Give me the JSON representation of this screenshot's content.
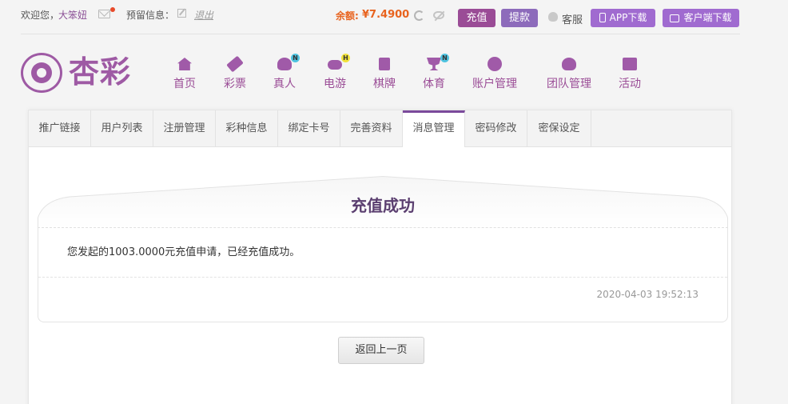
{
  "topbar": {
    "welcome": "欢迎您，",
    "username": "大笨妞",
    "reserve_label": "预留信息：",
    "logout": "退出",
    "balance_label": "余额:",
    "balance_value": "¥7.4900",
    "recharge": "充值",
    "withdraw": "提款",
    "customer_service": "客服",
    "app_download": "APP下载",
    "client_download": "客户端下载"
  },
  "logo": {
    "text": "杏彩"
  },
  "nav": [
    {
      "label": "首页",
      "icon": "home-icon"
    },
    {
      "label": "彩票",
      "icon": "lottery-ticket-icon"
    },
    {
      "label": "真人",
      "icon": "live-dealer-icon",
      "badge": "N"
    },
    {
      "label": "电游",
      "icon": "gamepad-icon",
      "badge": "H"
    },
    {
      "label": "棋牌",
      "icon": "cards-icon"
    },
    {
      "label": "体育",
      "icon": "trophy-icon",
      "badge": "N"
    },
    {
      "label": "账户管理",
      "icon": "coin-icon"
    },
    {
      "label": "团队管理",
      "icon": "team-icon"
    },
    {
      "label": "活动",
      "icon": "gift-icon"
    }
  ],
  "tabs": [
    "推广链接",
    "用户列表",
    "注册管理",
    "彩种信息",
    "绑定卡号",
    "完善资料",
    "消息管理",
    "密码修改",
    "密保设定"
  ],
  "active_tab": "消息管理",
  "message": {
    "title": "充值成功",
    "body": "您发起的1003.0000元充值申请，已经充值成功。",
    "time": "2020-04-03 19:52:13"
  },
  "back_button": "返回上一页",
  "colors": {
    "brand": "#9a4c96",
    "accent_purple": "#a06bd0",
    "balance": "#e8631e",
    "badge_n": "#4ec3e0",
    "badge_h": "#f2e23a"
  }
}
